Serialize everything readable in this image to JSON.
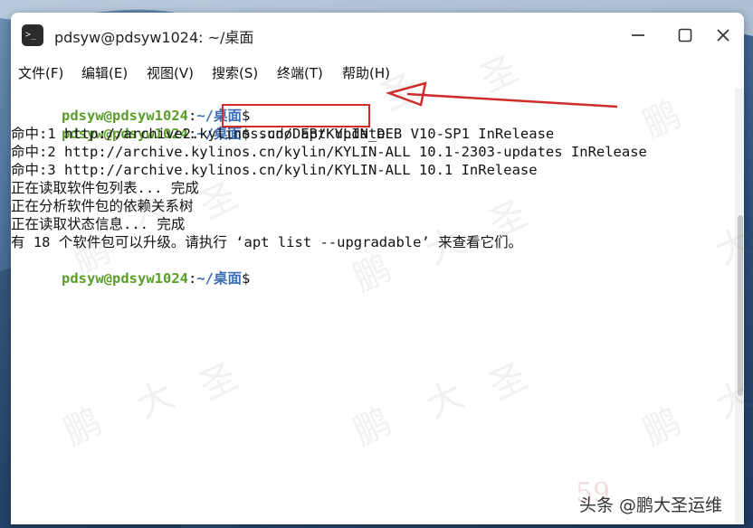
{
  "window": {
    "title": "pdsyw@pdsyw1024: ~/桌面",
    "minimize_icon": "minimize-icon",
    "maximize_icon": "maximize-icon",
    "close_icon": "close-icon",
    "app_icon_glyph": ">_"
  },
  "menu": [
    {
      "label": "文件(F)"
    },
    {
      "label": "编辑(E)"
    },
    {
      "label": "视图(V)"
    },
    {
      "label": "搜索(S)"
    },
    {
      "label": "终端(T)"
    },
    {
      "label": "帮助(H)"
    }
  ],
  "prompt": {
    "user": "pdsyw@pdsyw1024",
    "sep": ":",
    "path": "~/桌面",
    "symbol": "$"
  },
  "command": "sudo apt update",
  "output": [
    "命中:1 http://archive2.kylinos.cn/DEB/KYLIN_DEB V10-SP1 InRelease",
    "命中:2 http://archive.kylinos.cn/kylin/KYLIN-ALL 10.1-2303-updates InRelease",
    "命中:3 http://archive.kylinos.cn/kylin/KYLIN-ALL 10.1 InRelease",
    "正在读取软件包列表... 完成",
    "正在分析软件包的依赖关系树",
    "正在读取状态信息... 完成",
    "有 18 个软件包可以升级。请执行 ‘apt list --upgradable’ 来查看它们。"
  ],
  "watermark": {
    "char1": "鹏",
    "char2": "大",
    "char3": "圣"
  },
  "footer": {
    "site": "59",
    "credit": "头条 @鹏大圣运维"
  },
  "colors": {
    "prompt_user": "#5a9e2a",
    "prompt_path": "#3d6eb4",
    "annotation_red": "#d02c2c"
  }
}
